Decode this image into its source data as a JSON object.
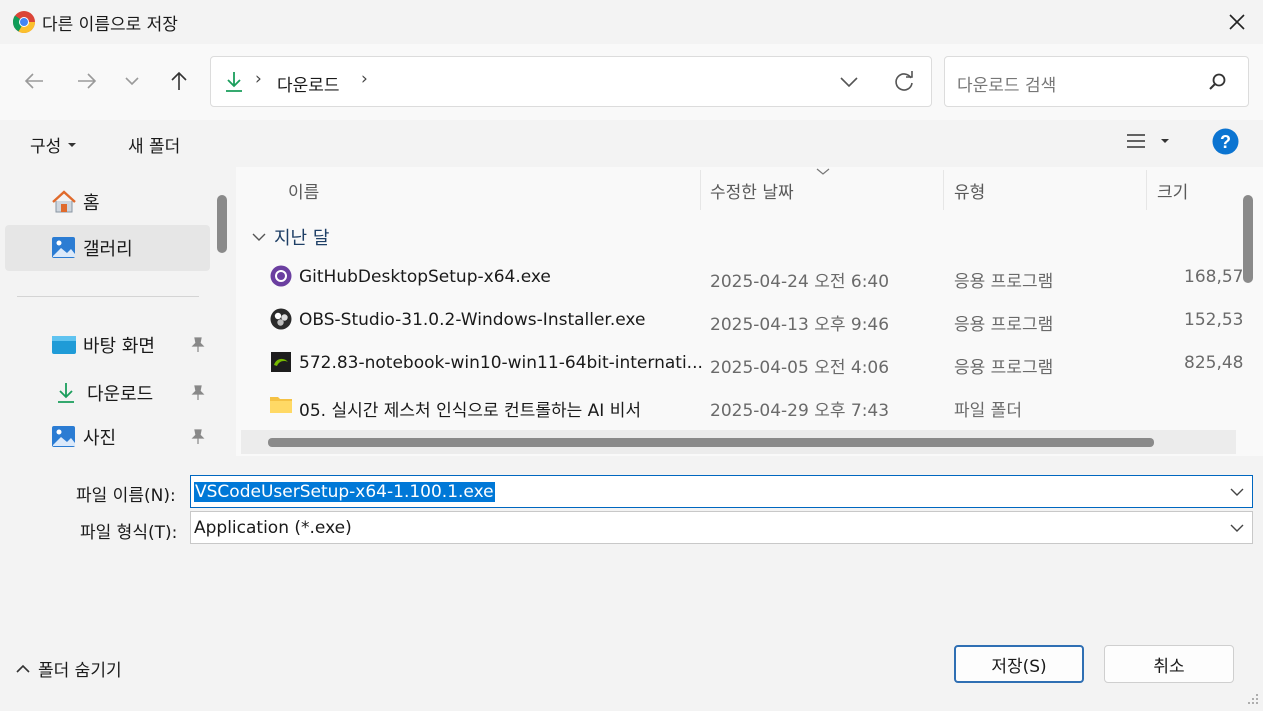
{
  "window": {
    "title": "다른 이름으로 저장"
  },
  "nav": {
    "breadcrumb_item": "다운로드",
    "search_placeholder": "다운로드 검색"
  },
  "toolbar": {
    "organize_label": "구성",
    "new_folder_label": "새 폴더"
  },
  "sidebar": {
    "items": [
      {
        "label": "홈",
        "icon": "home-icon",
        "pinned": false
      },
      {
        "label": "갤러리",
        "icon": "gallery-icon",
        "pinned": false,
        "selected": true
      },
      {
        "label": "바탕 화면",
        "icon": "desktop-icon",
        "pinned": true
      },
      {
        "label": "다운로드",
        "icon": "download-icon",
        "pinned": true
      },
      {
        "label": "사진",
        "icon": "pictures-icon",
        "pinned": true
      }
    ]
  },
  "columns": {
    "name": "이름",
    "modified": "수정한 날짜",
    "type": "유형",
    "size": "크기"
  },
  "group": {
    "label": "지난 달"
  },
  "files": [
    {
      "name": "GitHubDesktopSetup-x64.exe",
      "date": "2025-04-24 오전 6:40",
      "type": "응용 프로그램",
      "size": "168,57",
      "icon": "github-icon"
    },
    {
      "name": "OBS-Studio-31.0.2-Windows-Installer.exe",
      "date": "2025-04-13 오후 9:46",
      "type": "응용 프로그램",
      "size": "152,53",
      "icon": "obs-icon"
    },
    {
      "name": "572.83-notebook-win10-win11-64bit-internati...",
      "date": "2025-04-05 오전 4:06",
      "type": "응용 프로그램",
      "size": "825,48",
      "icon": "nvidia-icon"
    },
    {
      "name": "05. 실시간 제스처 인식으로 컨트롤하는 AI 비서",
      "date": "2025-04-29 오후 7:43",
      "type": "파일 폴더",
      "size": "",
      "icon": "folder-icon"
    }
  ],
  "form": {
    "filename_label": "파일 이름(N):",
    "filename_value": "VSCodeUserSetup-x64-1.100.1.exe",
    "filetype_label": "파일 형식(T):",
    "filetype_value": "Application (*.exe)"
  },
  "footer": {
    "hide_folders_label": "폴더 숨기기",
    "save_label": "저장(S)",
    "cancel_label": "취소"
  },
  "colors": {
    "accent": "#0067c0",
    "selection": "#0078d7",
    "help": "#0b74d1"
  }
}
